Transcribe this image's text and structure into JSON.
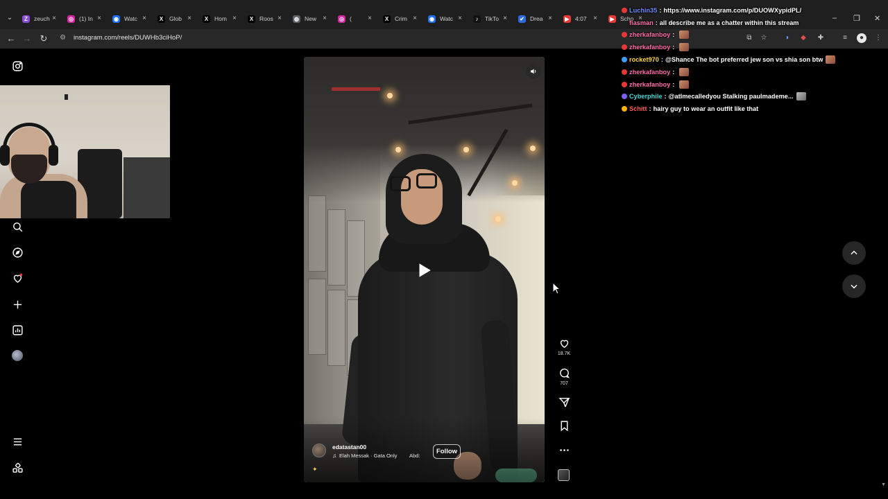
{
  "browser": {
    "tabs": [
      {
        "title": "zeuch",
        "color": "#8a4bd6",
        "glyph": "Z"
      },
      {
        "title": "(1) In",
        "color": "#d6249f",
        "glyph": "◎"
      },
      {
        "title": "Watc",
        "color": "#1d6ff2",
        "glyph": "◉"
      },
      {
        "title": "Glob",
        "color": "#000000",
        "glyph": "X"
      },
      {
        "title": "Hom",
        "color": "#000000",
        "glyph": "X"
      },
      {
        "title": "Roos",
        "color": "#000000",
        "glyph": "X"
      },
      {
        "title": "New",
        "color": "#5f6368",
        "glyph": "◍"
      },
      {
        "title": "(",
        "color": "#d6249f",
        "glyph": "◎"
      },
      {
        "title": "Crim",
        "color": "#000000",
        "glyph": "X"
      },
      {
        "title": "Watc",
        "color": "#1d6ff2",
        "glyph": "◉"
      },
      {
        "title": "TikTo",
        "color": "#111111",
        "glyph": "♪"
      },
      {
        "title": "Drea",
        "color": "#2d6cdf",
        "glyph": "✔"
      },
      {
        "title": "4:07",
        "color": "#e53935",
        "glyph": "▶"
      },
      {
        "title": "Scho",
        "color": "#e53935",
        "glyph": "▶"
      }
    ],
    "tab_close": "×",
    "url": "instagram.com/reels/DUWHb3ciHoP/",
    "window_controls": {
      "minimize": "–",
      "maximize": "❐",
      "close": "✕"
    }
  },
  "chat": [
    {
      "name": "Luchin35",
      "name_color": "#6c8cff",
      "badge_color": "#e53935",
      "message": "https://www.instagram.com/p/DUOWXypidPL/",
      "emote": ""
    },
    {
      "name": "fiasman",
      "name_color": "#ff6fa8",
      "badge_color": "",
      "message": "all describe me as a chatter within this stream",
      "emote": ""
    },
    {
      "name": "zherkafanboy",
      "name_color": "#ff6aa8",
      "badge_color": "#e53935",
      "message": "",
      "emote": "face"
    },
    {
      "name": "zherkafanboy",
      "name_color": "#ff6aa8",
      "badge_color": "#e53935",
      "message": "",
      "emote": "face"
    },
    {
      "name": "rocket970",
      "name_color": "#ffd54a",
      "badge_color": "#3aa0ff",
      "message": "@Shance The bot preferred jew son vs shia son btw",
      "emote": "face"
    },
    {
      "name": "zherkafanboy",
      "name_color": "#ff6aa8",
      "badge_color": "#e53935",
      "message": "",
      "emote": "face"
    },
    {
      "name": "zherkafanboy",
      "name_color": "#ff6aa8",
      "badge_color": "#e53935",
      "message": "",
      "emote": "face"
    },
    {
      "name": "Cyberphile",
      "name_color": "#3fd6d6",
      "badge_color": "#7b61ff",
      "message": "@atImecalledyou Stalking paulmademe...",
      "emote": "grey"
    },
    {
      "name": "Schitt",
      "name_color": "#ff5a5a",
      "badge_color": "#ffb300",
      "message": "hairy guy to wear an outfit like that",
      "emote": ""
    }
  ],
  "reel": {
    "author": "edatastan00",
    "audio": "Elah Messak · Gata Only",
    "audio_extra": "Abd:",
    "follow_label": "Follow",
    "likes": "18.7K",
    "comments": "707"
  },
  "colors": {
    "page_bg": "#000000",
    "tabstrip_bg": "#1f1f1f",
    "toolbar_bg": "#282828",
    "notification_dot": "#ff3040"
  }
}
